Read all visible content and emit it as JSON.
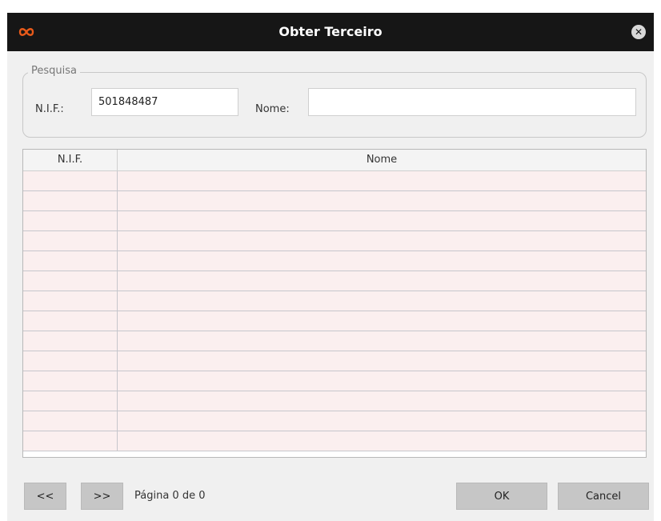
{
  "window": {
    "title": "Obter Terceiro",
    "close_symbol": "✕",
    "accent": "#e85a1a",
    "titlebar_color": "#161616"
  },
  "search": {
    "legend": "Pesquisa",
    "nif_label": "N.I.F.:",
    "nif_value": "501848487",
    "nome_label": "Nome:",
    "nome_value": ""
  },
  "table": {
    "columns": [
      "N.I.F.",
      "Nome"
    ],
    "row_color": "#fbefef",
    "rows": [
      [
        "",
        ""
      ],
      [
        "",
        ""
      ],
      [
        "",
        ""
      ],
      [
        "",
        ""
      ],
      [
        "",
        ""
      ],
      [
        "",
        ""
      ],
      [
        "",
        ""
      ],
      [
        "",
        ""
      ],
      [
        "",
        ""
      ],
      [
        "",
        ""
      ],
      [
        "",
        ""
      ],
      [
        "",
        ""
      ],
      [
        "",
        ""
      ],
      [
        "",
        ""
      ]
    ]
  },
  "footer": {
    "prev_label": "<<",
    "next_label": ">>",
    "page_text": "Página 0 de 0",
    "ok_label": "OK",
    "cancel_label": "Cancel"
  }
}
